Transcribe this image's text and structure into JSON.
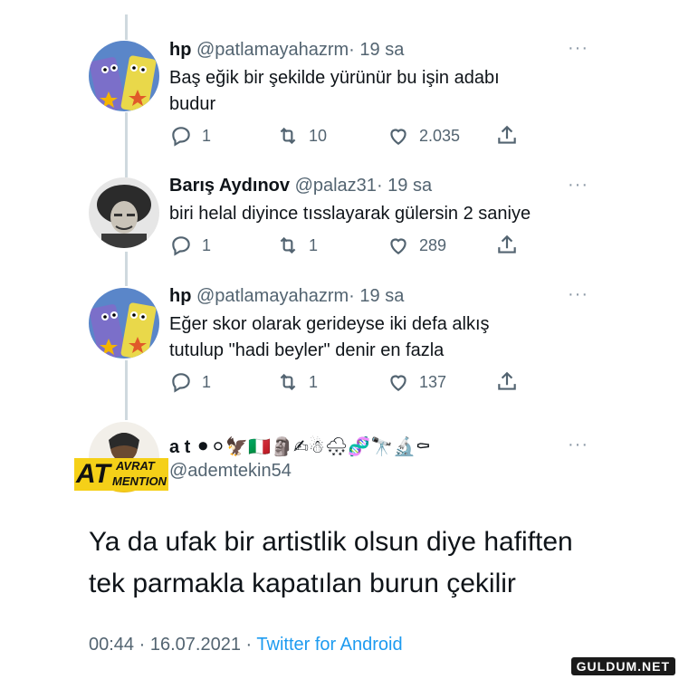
{
  "replies": [
    {
      "name": "hp",
      "handle": "@patlamayahazrm",
      "dot": "·",
      "time": "19 sa",
      "text_line1": "Baş eğik bir şekilde yürünür bu işin adabı",
      "text_line2": "budur",
      "replies": "1",
      "retweets": "10",
      "likes": "2.035"
    },
    {
      "name": "Barış Aydınov",
      "handle": "@palaz31",
      "dot": "·",
      "time": "19 sa",
      "text_line1": "biri helal diyince tısslayarak gülersin 2 saniye",
      "replies": "1",
      "retweets": "1",
      "likes": "289"
    },
    {
      "name": "hp",
      "handle": "@patlamayahazrm",
      "dot": "·",
      "time": "19 sa",
      "text_line1": "Eğer skor olarak gerideyse iki defa alkış",
      "text_line2": "tutulup \"hadi beyler\" denir en fazla",
      "replies": "1",
      "retweets": "1",
      "likes": "137"
    }
  ],
  "main": {
    "name": "a t",
    "name_emojis": "⚫⚪🦅🇮🇹🗿✍☃🌨🧬🔭🔬⚰",
    "handle": "@ademtekin54",
    "avatar_overlay_top": "AVRAT",
    "avatar_overlay_big": "AT",
    "avatar_overlay_bottom": "MENTION",
    "text_line1": "Ya da ufak bir artistlik olsun diye hafiften",
    "text_line2": "tek parmakla kapatılan burun çekilir",
    "time": "00:44",
    "sep1": "·",
    "date": "16.07.2021",
    "sep2": "·",
    "source": "Twitter for Android"
  },
  "more_label": "···",
  "watermark": "GULDUM.NET",
  "colors": {
    "link": "#1d9bf0",
    "muted": "#536471",
    "thread_line": "#cfd9de"
  }
}
